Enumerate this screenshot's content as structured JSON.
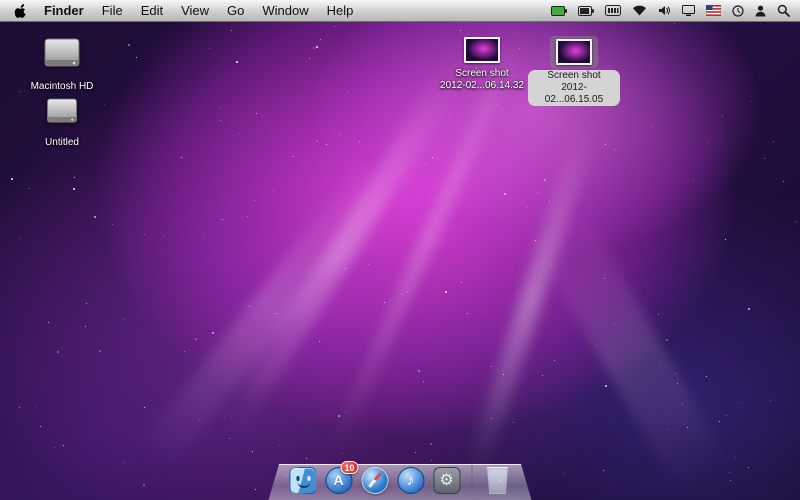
{
  "menu_bar": {
    "apple_icon": "apple-logo",
    "menus": [
      "Finder",
      "File",
      "Edit",
      "View",
      "Go",
      "Window",
      "Help"
    ],
    "active_app": "Finder",
    "status_icons": [
      "battery-green",
      "battery-meter",
      "indicator-box",
      "wifi",
      "volume",
      "display",
      "keyboard-flag",
      "clock",
      "user",
      "spotlight"
    ]
  },
  "desktop_icons": [
    {
      "label": "Macintosh HD",
      "type": "drive",
      "selected": false
    },
    {
      "label": "Untitled",
      "type": "drive",
      "selected": false
    },
    {
      "label_line1": "Screen shot",
      "label_line2": "2012-02...06.14.32",
      "type": "image-file",
      "selected": false
    },
    {
      "label_line1": "Screen shot",
      "label_line2": "2012-02...06.15.05",
      "type": "image-file",
      "selected": true
    }
  ],
  "dock": {
    "items": [
      {
        "name": "finder"
      },
      {
        "name": "app-store",
        "badge": "10",
        "glyph": "A"
      },
      {
        "name": "safari"
      },
      {
        "name": "itunes",
        "glyph": "♪"
      },
      {
        "name": "system-preferences",
        "glyph": "⚙"
      },
      {
        "name": "trash"
      }
    ]
  },
  "colors": {
    "menubar_top": "#f7f7f7",
    "menubar_bottom": "#b8b8b8",
    "wallpaper_accent": "#fa46eb",
    "badge_red": "#d41414",
    "selection_gray": "#d4d4d4"
  }
}
